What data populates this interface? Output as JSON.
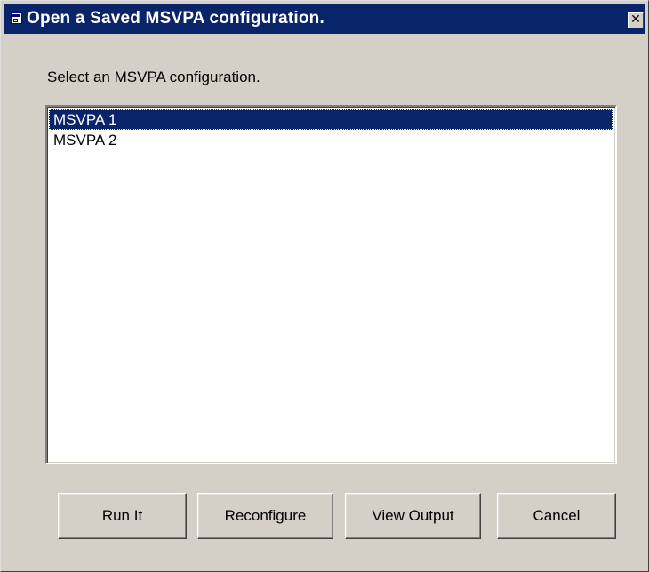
{
  "window": {
    "title": "Open a Saved MSVPA configuration.",
    "close_glyph": "✕",
    "colors": {
      "titlebar": "#0a246a",
      "face": "#d4d0c8",
      "selection": "#0a246a"
    },
    "icons": [
      "app-icon",
      "close-icon"
    ]
  },
  "prompt": {
    "label": "Select an MSVPA configuration."
  },
  "config_list": {
    "items": [
      {
        "label": "MSVPA 1",
        "selected": true
      },
      {
        "label": "MSVPA 2",
        "selected": false
      }
    ]
  },
  "buttons": {
    "run": "Run It",
    "reconfigure": "Reconfigure",
    "view_output": "View Output",
    "cancel": "Cancel"
  }
}
